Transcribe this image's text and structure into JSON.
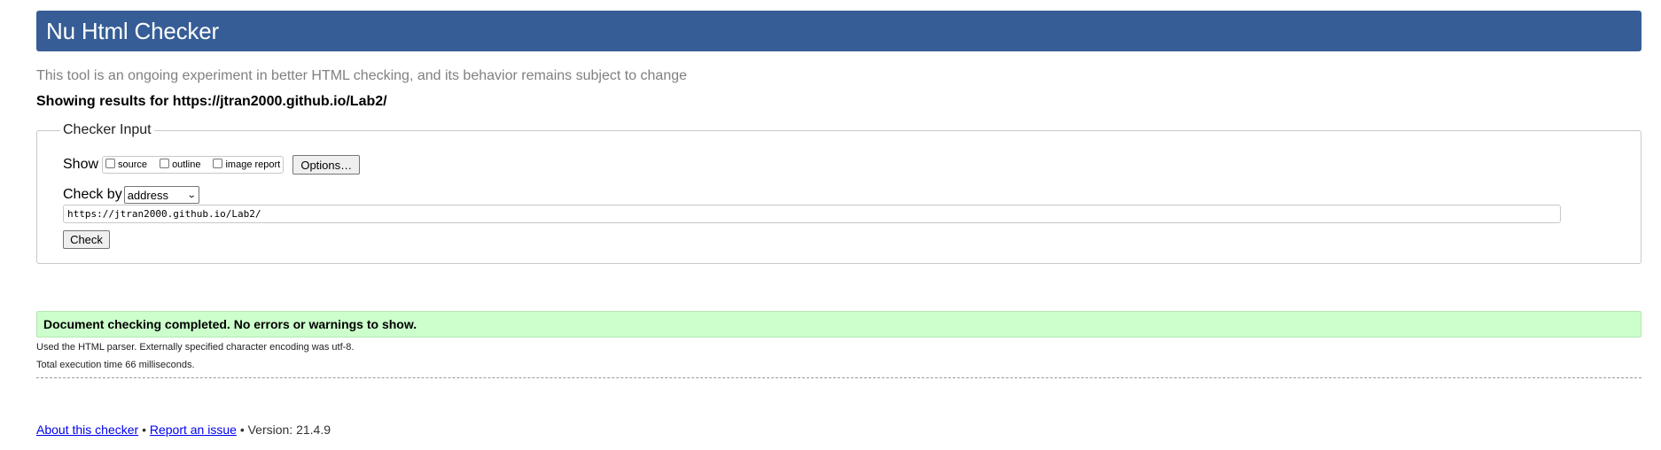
{
  "header": {
    "title": "Nu Html Checker"
  },
  "intro_text": "This tool is an ongoing experiment in better HTML checking, and its behavior remains subject to change",
  "results_heading": "Showing results for https://jtran2000.github.io/Lab2/",
  "checker_input": {
    "legend": "Checker Input",
    "show_label": "Show",
    "checkboxes": [
      {
        "label": "source",
        "checked": false
      },
      {
        "label": "outline",
        "checked": false
      },
      {
        "label": "image report",
        "checked": false
      }
    ],
    "options_button": "Options…",
    "check_by_label": "Check by",
    "check_by_value": "address",
    "url_value": "https://jtran2000.github.io/Lab2/",
    "check_button": "Check"
  },
  "result": {
    "success_message": "Document checking completed. No errors or warnings to show.",
    "parser_info": "Used the HTML parser. Externally specified character encoding was utf-8.",
    "execution_time": "Total execution time 66 milliseconds."
  },
  "footer": {
    "about_link": "About this checker",
    "separator": "•",
    "report_link": "Report an issue",
    "version_text": "Version: 21.4.9"
  },
  "colors": {
    "header_bg": "#365D95",
    "success_bg": "#ccffcc",
    "link": "#0000ee"
  }
}
